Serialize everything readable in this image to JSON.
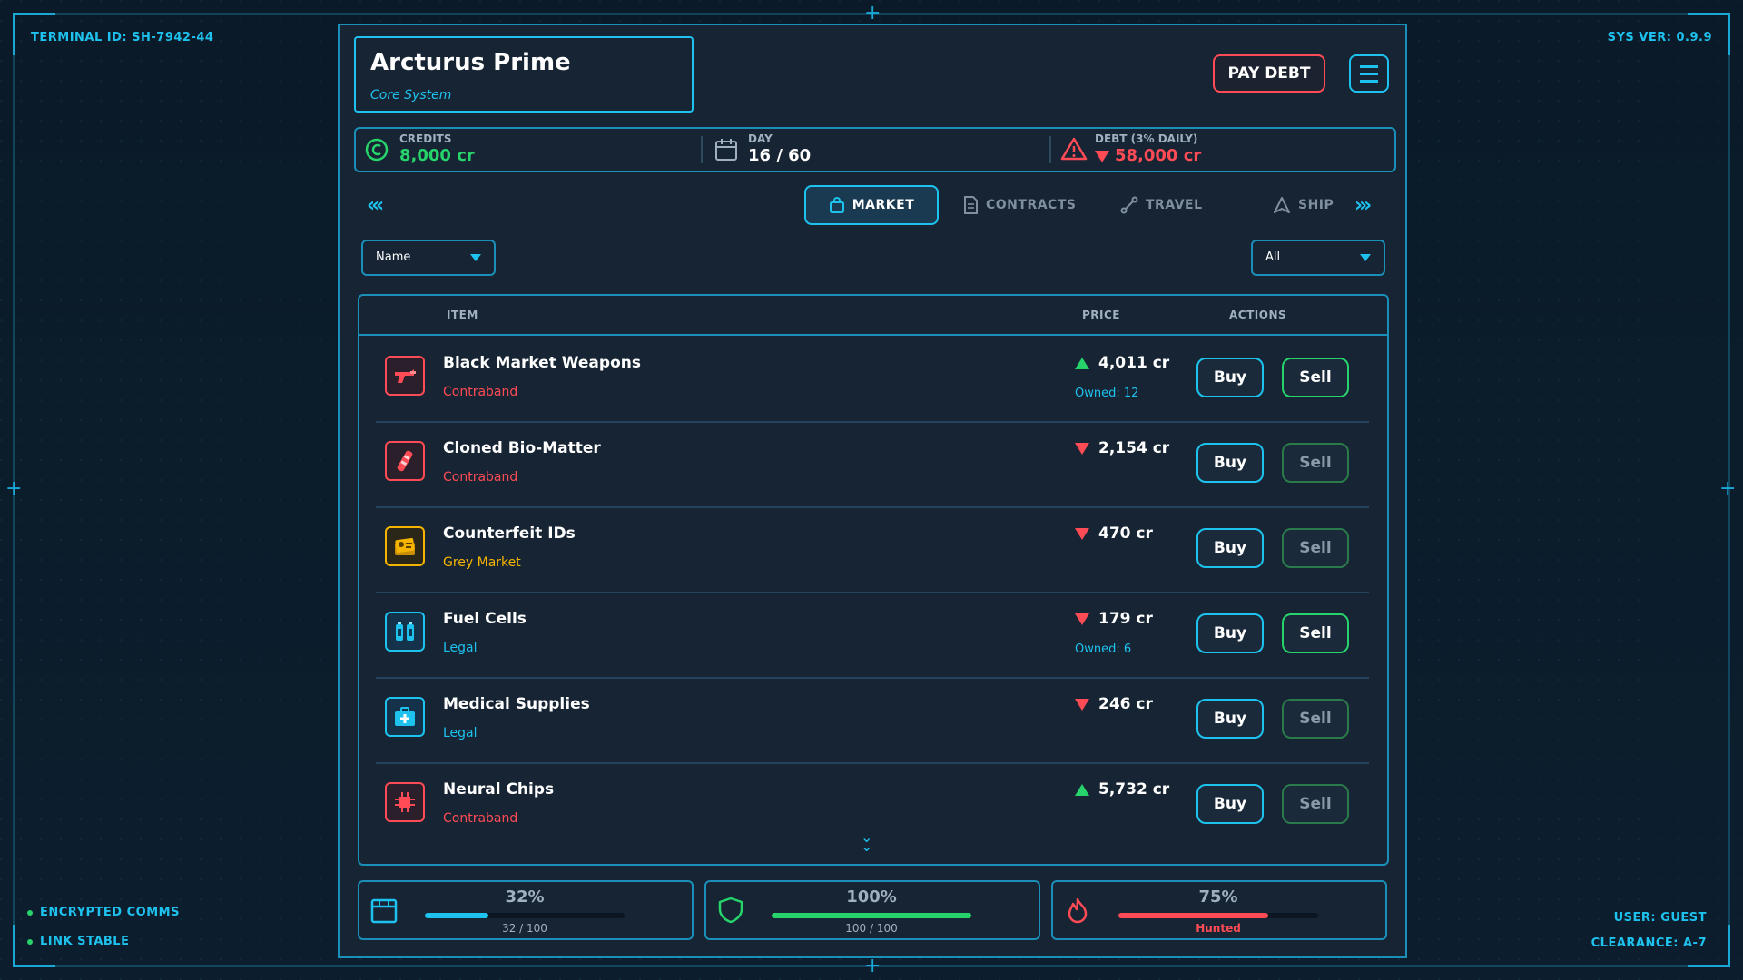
{
  "hud": {
    "terminal_id": "TERMINAL ID: SH-7942-44",
    "sys_ver": "SYS VER: 0.9.9",
    "comms": "ENCRYPTED COMMS",
    "link": "LINK STABLE",
    "user": "USER: GUEST",
    "clearance": "CLEARANCE: A-7"
  },
  "location": {
    "name": "Arcturus Prime",
    "system": "Core System"
  },
  "header": {
    "pay_debt_label": "PAY DEBT"
  },
  "stats": {
    "credits_label": "CREDITS",
    "credits_value": "8,000 cr",
    "day_label": "DAY",
    "day_value": "16 / 60",
    "debt_label": "DEBT (3% DAILY)",
    "debt_value": "58,000 cr"
  },
  "tabs": [
    {
      "label": "MARKET",
      "active": true
    },
    {
      "label": "CONTRACTS",
      "active": false
    },
    {
      "label": "TRAVEL",
      "active": false
    },
    {
      "label": "SHIP",
      "active": false
    }
  ],
  "filters": {
    "sort_selected": "Name",
    "category_selected": "All"
  },
  "table": {
    "headers": {
      "item": "ITEM",
      "price": "PRICE",
      "actions": "ACTIONS"
    },
    "buy_label": "Buy",
    "sell_label": "Sell",
    "rows": [
      {
        "name": "Black Market Weapons",
        "category": "Contraband",
        "price": "4,011 cr",
        "trend": "up",
        "owned": "Owned: 12"
      },
      {
        "name": "Cloned Bio-Matter",
        "category": "Contraband",
        "price": "2,154 cr",
        "trend": "down",
        "owned": ""
      },
      {
        "name": "Counterfeit IDs",
        "category": "Grey Market",
        "price": "470 cr",
        "trend": "down",
        "owned": ""
      },
      {
        "name": "Fuel Cells",
        "category": "Legal",
        "price": "179 cr",
        "trend": "down",
        "owned": "Owned: 6"
      },
      {
        "name": "Medical Supplies",
        "category": "Legal",
        "price": "246 cr",
        "trend": "down",
        "owned": ""
      },
      {
        "name": "Neural Chips",
        "category": "Contraband",
        "price": "5,732 cr",
        "trend": "up",
        "owned": ""
      }
    ]
  },
  "meters": {
    "cargo": {
      "pct": "32%",
      "caption": "32 / 100",
      "fill": 0.32
    },
    "hull": {
      "pct": "100%",
      "caption": "100 / 100",
      "fill": 1.0
    },
    "heat": {
      "pct": "75%",
      "caption": "Hunted",
      "fill": 0.75
    }
  },
  "colors": {
    "accent": "#1ec2ee",
    "contraband": "#ff4b55",
    "grey_market": "#f5b400",
    "legal": "#1ec2ee",
    "positive": "#27d36b"
  }
}
